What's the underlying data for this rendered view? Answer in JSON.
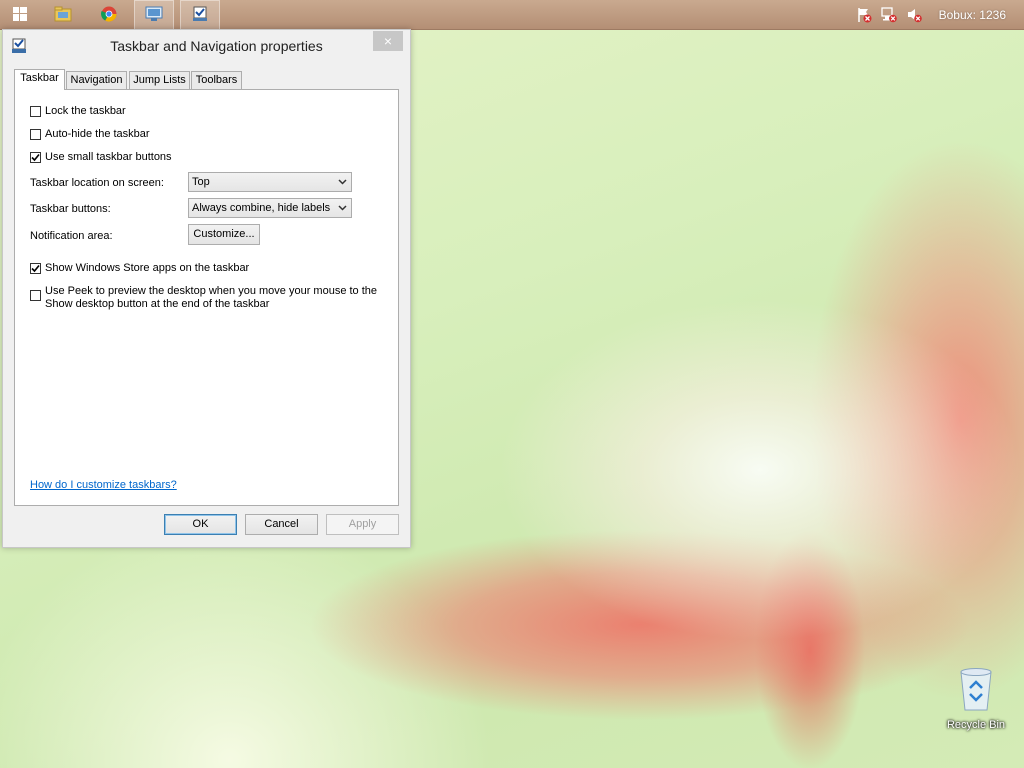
{
  "taskbar": {
    "clock": "Bobux: 1236"
  },
  "dialog": {
    "title": "Taskbar and Navigation properties",
    "close_glyph": "×",
    "tabs": [
      {
        "label": "Taskbar",
        "selected": true
      },
      {
        "label": "Navigation",
        "selected": false
      },
      {
        "label": "Jump Lists",
        "selected": false
      },
      {
        "label": "Toolbars",
        "selected": false
      }
    ],
    "checkboxes": {
      "lock": {
        "label": "Lock the taskbar",
        "checked": false
      },
      "autohide": {
        "label": "Auto-hide the taskbar",
        "checked": false
      },
      "small": {
        "label": "Use small taskbar buttons",
        "checked": true
      },
      "store": {
        "label": "Show Windows Store apps on the taskbar",
        "checked": true
      },
      "peek": {
        "label": "Use Peek to preview the desktop when you move your mouse to the Show desktop button at the end of the taskbar",
        "checked": false
      }
    },
    "location": {
      "label": "Taskbar location on screen:",
      "value": "Top"
    },
    "buttons_setting": {
      "label": "Taskbar buttons:",
      "value": "Always combine, hide labels"
    },
    "notification": {
      "label": "Notification area:",
      "button": "Customize..."
    },
    "help_link": "How do I customize taskbars?",
    "ok": "OK",
    "cancel": "Cancel",
    "apply": "Apply"
  },
  "desktop": {
    "recycle_bin": "Recycle Bin"
  },
  "colors": {
    "link": "#0066cc",
    "taskbar": "#b99a80",
    "close_button": "#c7c7c7"
  }
}
